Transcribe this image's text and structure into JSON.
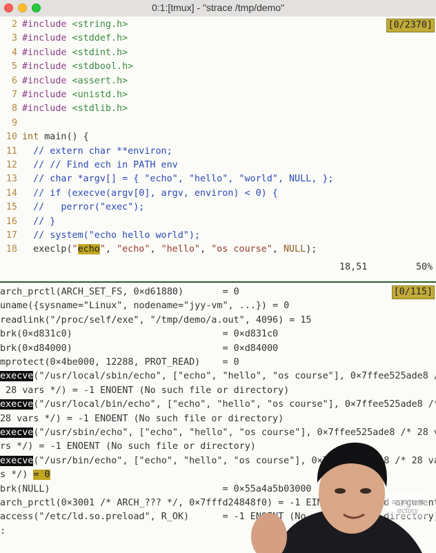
{
  "window": {
    "title": "0:1:[tmux] - \"strace /tmp/demo\""
  },
  "editor": {
    "position_badge": "[0/2370]",
    "status_pos": "18,51",
    "status_pct": "50%",
    "lines": [
      {
        "n": "2",
        "pp": "#include",
        "inc": " <string.h>"
      },
      {
        "n": "3",
        "pp": "#include",
        "inc": " <stddef.h>"
      },
      {
        "n": "4",
        "pp": "#include",
        "inc": " <stdint.h>"
      },
      {
        "n": "5",
        "pp": "#include",
        "inc": " <stdbool.h>"
      },
      {
        "n": "6",
        "pp": "#include",
        "inc": " <assert.h>"
      },
      {
        "n": "7",
        "pp": "#include",
        "inc": " <unistd.h>"
      },
      {
        "n": "8",
        "pp": "#include",
        "inc": " <stdlib.h>"
      },
      {
        "n": "9"
      },
      {
        "n": "10",
        "kw": "int",
        "rest": " main() {"
      },
      {
        "n": "11",
        "cm": "  // extern char **environ;"
      },
      {
        "n": "12",
        "cm": "  // // Find ech in PATH env"
      },
      {
        "n": "13",
        "cm": "  // char *argv[] = { \"echo\", \"hello\", \"world\", NULL, };"
      },
      {
        "n": "14",
        "cm": "  // if (execve(argv[0], argv, environ) < 0) {"
      },
      {
        "n": "15",
        "cm": "  //   perror(\"exec\");"
      },
      {
        "n": "16",
        "cm": "  // }"
      },
      {
        "n": "17",
        "cm": "  // system(\"echo hello world\");"
      },
      {
        "n": "18",
        "l18": {
          "a": "  execlp(",
          "b": "\"",
          "hl": "echo",
          "c": "\"",
          "d": ", ",
          "s1": "\"echo\"",
          "e": ", ",
          "s2": "\"hello\"",
          "f": ", ",
          "s3": "\"os course\"",
          "g": ", ",
          "nul": "NULL",
          "h": ");"
        }
      }
    ]
  },
  "strace": {
    "position_badge": "[0/115]",
    "prompt": ":",
    "lines": [
      {
        "t": "arch_prctl(ARCH_SET_FS, 0×d61880)       = 0"
      },
      {
        "t": "uname({sysname=\"Linux\", nodename=\"jyy-vm\", ...}) = 0"
      },
      {
        "t": "readlink(\"/proc/self/exe\", \"/tmp/demo/a.out\", 4096) = 15"
      },
      {
        "t": "brk(0×d831c0)                           = 0×d831c0"
      },
      {
        "t": "brk(0×d84000)                           = 0×d84000"
      },
      {
        "t": "mprotect(0×4be000, 12288, PROT_READ)    = 0"
      },
      {
        "sel": "execve",
        "t": "(\"/usr/local/sbin/echo\", [\"echo\", \"hello\", \"os course\"], 0×7ffee525ade8 /*"
      },
      {
        "t": " 28 vars */) = -1 ENOENT (No such file or directory)"
      },
      {
        "sel": "execve",
        "t": "(\"/usr/local/bin/echo\", [\"echo\", \"hello\", \"os course\"], 0×7ffee525ade8 /*"
      },
      {
        "t": "28 vars */) = -1 ENOENT (No such file or directory)"
      },
      {
        "sel": "execve",
        "t": "(\"/usr/sbin/echo\", [\"echo\", \"hello\", \"os course\"], 0×7ffee525ade8 /* 28 va"
      },
      {
        "t": "rs */) = -1 ENOENT (No such file or directory)"
      },
      {
        "sel": "execve",
        "t": "(\"/usr/bin/echo\", [\"echo\", \"hello\", \"os course\"], 0×7ffee525ade8 /* 28 va"
      },
      {
        "t": "s */) ",
        "hl": "= 0"
      },
      {
        "t": "brk(NULL)                               = 0×55a4a5b03000"
      },
      {
        "t": "arch_prctl(0×3001 /* ARCH_??? */, 0×7fffd24848f0) = -1 EINVAL (Invalid argument)"
      },
      {
        "t": "access(\"/etc/ld.so.preload\", R_OK)      = -1 ENOENT (No such file or directory)"
      }
    ]
  },
  "watermark": {
    "line1": "argument",
    "line2": "ectory"
  },
  "colors": {
    "line_number": "#b4873d",
    "preprocessor": "#8b3f87",
    "include_path": "#3b8a3e",
    "keyword": "#8f6a1f",
    "comment": "#2c49b4",
    "string": "#9a3a2d",
    "search_highlight": "#c1a622",
    "badge": "#c2ab39"
  }
}
